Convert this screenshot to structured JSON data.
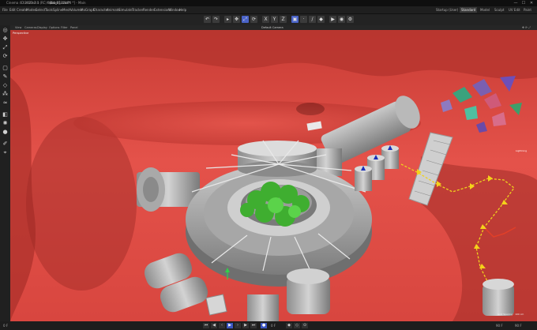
{
  "window": {
    "title": "Cinema 4D 2023.2.0 (RC) - [fabio_01.c4d *] - Main",
    "minimize": "—",
    "maximize": "☐",
    "close": "✕"
  },
  "tabs": [
    "Untitled 1",
    "fabio_01.c4d *"
  ],
  "menubar": {
    "items": [
      "File",
      "Edit",
      "Create",
      "Modes",
      "Select",
      "Tools",
      "Spline",
      "Mesh",
      "Volume",
      "MoGraph",
      "Character",
      "Animate",
      "Simulate",
      "Tracker",
      "Render",
      "Extensions",
      "Window",
      "Help"
    ],
    "layouts": [
      "Startup (User)",
      "Standard",
      "Model",
      "Sculpt",
      "UV Edit",
      "Paint"
    ],
    "active_layout": "Standard"
  },
  "viewport": {
    "menus": [
      "View",
      "Cameras",
      "Display",
      "Options",
      "Filter",
      "Panel"
    ],
    "camera_label": "Default Camera",
    "view_name": "Perspective",
    "grid_spacing": "Grid Spacing : 100 cm",
    "object_label": "Lightning"
  },
  "timeline": {
    "current_frame": "0 F",
    "start_frame": "0 F",
    "end_frame": "90 F",
    "fps": "90 F"
  },
  "icons": [
    "move-icon",
    "scale-icon",
    "rotate-icon",
    "select-icon",
    "render-icon",
    "play-icon"
  ],
  "colors": {
    "accent": "#4a63c7",
    "viewport_bg": "#d9453d",
    "spline": "#f0d21c",
    "foliage": "#44b534"
  }
}
